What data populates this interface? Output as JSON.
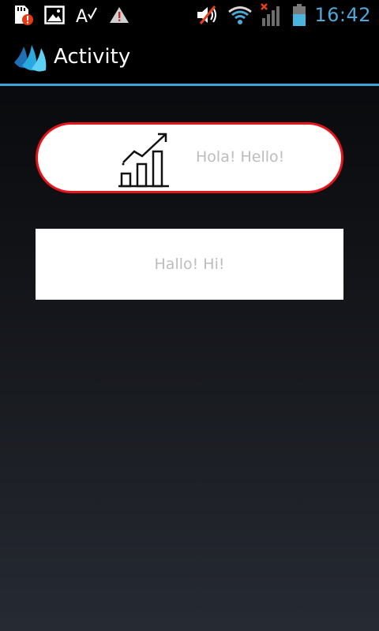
{
  "status_bar": {
    "time": "16:42",
    "left_icons": [
      "sd-card-warning-icon",
      "image-icon",
      "spellcheck-icon",
      "warning-icon"
    ],
    "right_icons": [
      "volume-muted-icon",
      "wifi-icon",
      "signal-no-service-icon",
      "battery-icon"
    ],
    "time_color": "#4aa9d8"
  },
  "action_bar": {
    "title": "Activity",
    "icon": "app-logo-icon",
    "divider_color": "#3aa5d6"
  },
  "buttons": {
    "primary": {
      "label": "Hola! Hello!",
      "icon": "growth-chart-icon",
      "border_color": "#e8141c"
    },
    "secondary": {
      "label": "Hallo! Hi!"
    }
  }
}
